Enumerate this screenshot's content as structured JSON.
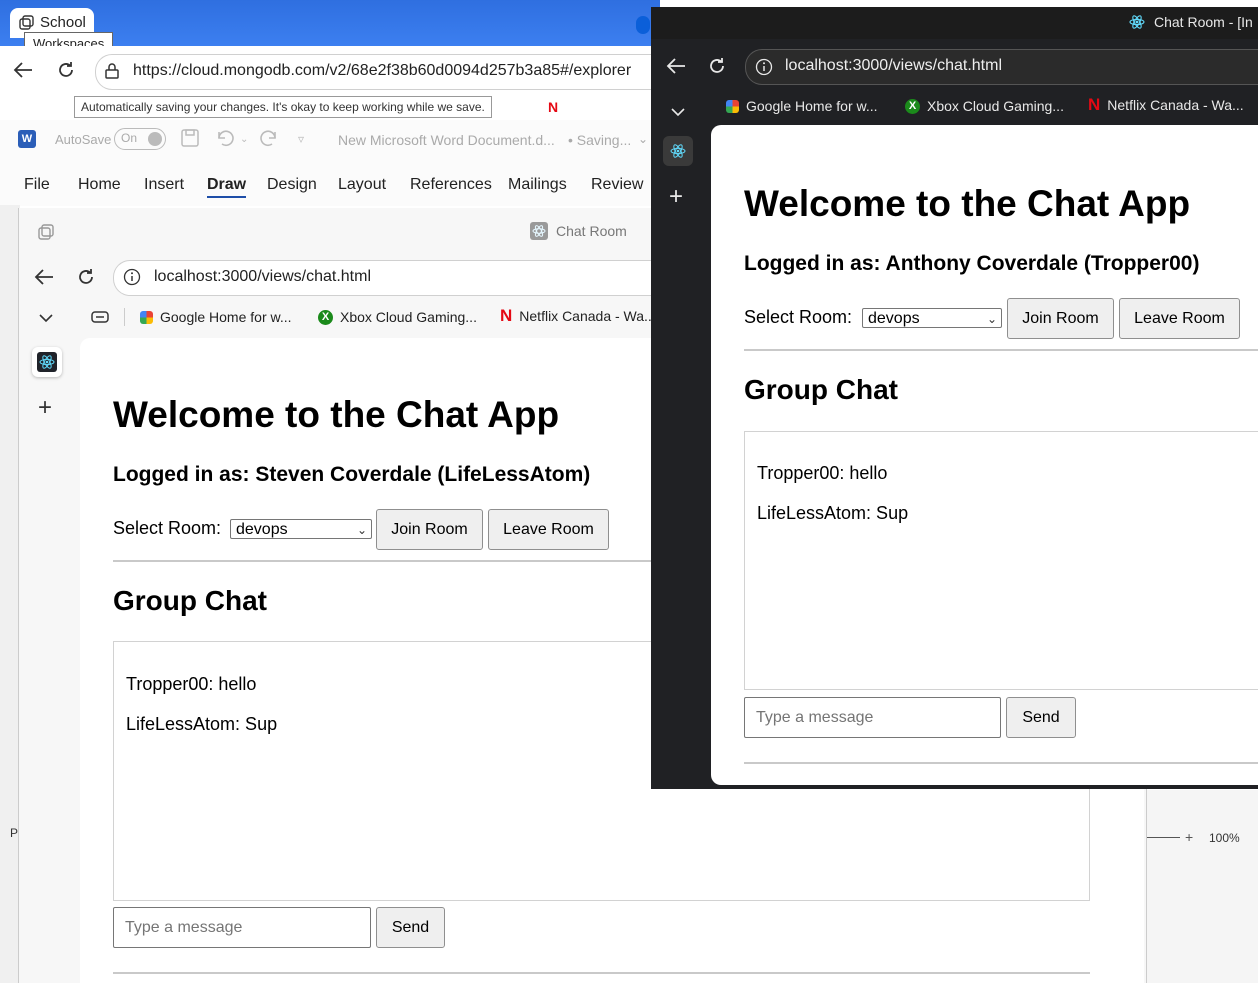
{
  "background_browser": {
    "tab_label": "School",
    "tooltip": "Workspaces",
    "url": "https://cloud.mongodb.com/v2/68e2f38b60d0094d257b3a85#/explorer",
    "autosave_tooltip": "Automatically saving your changes. It's okay to keep working while we save."
  },
  "word": {
    "autosave_label": "AutoSave",
    "autosave_state": "On",
    "doc_title": "New Microsoft Word Document.d...",
    "saving_status": "• Saving...",
    "menu": [
      "File",
      "Home",
      "Insert",
      "Draw",
      "Design",
      "Layout",
      "References",
      "Mailings",
      "Review"
    ],
    "zoom": "100%",
    "status_left": "P"
  },
  "win1": {
    "tab_title": "Chat Room",
    "url": "localhost:3000/views/chat.html",
    "bookmarks": [
      "Google Home for w...",
      "Xbox Cloud Gaming...",
      "Netflix Canada - Wa..."
    ],
    "app": {
      "title": "Welcome to the Chat App",
      "logged_in": "Logged in as: Steven Coverdale (LifeLessAtom)",
      "select_label": "Select Room:",
      "room": "devops",
      "join_label": "Join Room",
      "leave_label": "Leave Room",
      "group_title": "Group Chat",
      "messages": [
        "Tropper00: hello",
        "LifeLessAtom: Sup"
      ],
      "input_placeholder": "Type a message",
      "send_label": "Send"
    }
  },
  "win2": {
    "tab_title": "Chat Room - [In",
    "url": "localhost:3000/views/chat.html",
    "bookmarks": [
      "Google Home for w...",
      "Xbox Cloud Gaming...",
      "Netflix Canada - Wa..."
    ],
    "app": {
      "title": "Welcome to the Chat App",
      "logged_in": "Logged in as: Anthony Coverdale (Tropper00)",
      "select_label": "Select Room:",
      "room": "devops",
      "join_label": "Join Room",
      "leave_label": "Leave Room",
      "group_title": "Group Chat",
      "messages": [
        "Tropper00: hello",
        "LifeLessAtom: Sup"
      ],
      "input_placeholder": "Type a message",
      "send_label": "Send"
    }
  },
  "colors": {
    "edge_blue": "#2f6fe0",
    "dark_window": "#202124",
    "word_blue": "#1e4ea8",
    "netflix_red": "#e50914",
    "xbox_green": "#1b8a1b"
  }
}
